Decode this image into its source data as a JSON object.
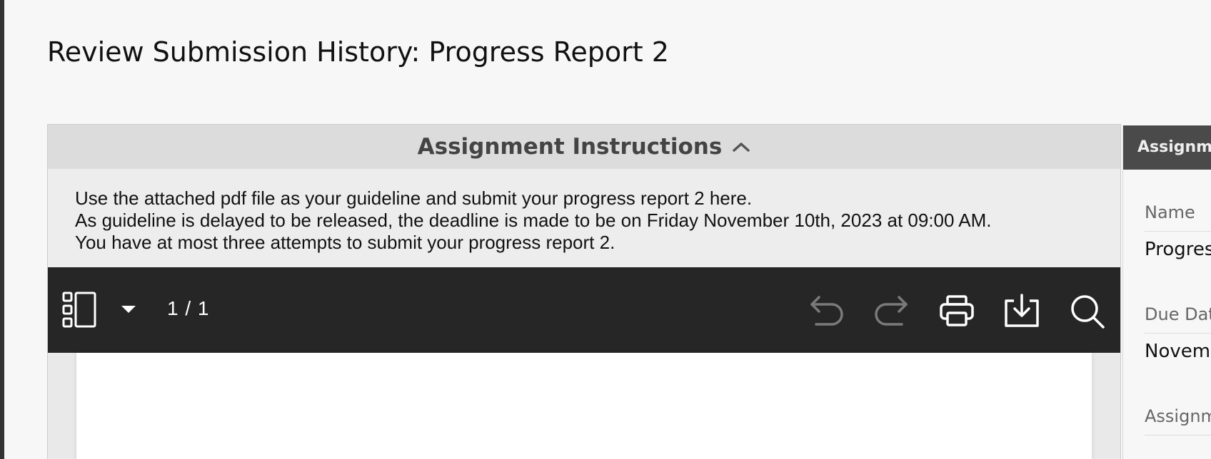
{
  "page": {
    "title": "Review Submission History: Progress Report 2"
  },
  "instructions": {
    "header_label": "Assignment Instructions",
    "toggle_icon": "chevron-up-icon",
    "lines": [
      "Use the attached pdf file as your guideline and submit your progress report 2 here.",
      "As guideline is delayed to be released, the deadline is made to be on Friday November 10th, 2023 at 09:00 AM.",
      "You have at most three attempts to submit your progress report 2."
    ]
  },
  "pdf_toolbar": {
    "page_indicator": "1 / 1",
    "icons": {
      "sidebar": "sidebar-toggle-icon",
      "dropdown": "caret-down-icon",
      "undo": "undo-icon",
      "redo": "redo-icon",
      "print": "print-icon",
      "download": "download-icon",
      "search": "search-icon"
    }
  },
  "side_panel": {
    "header": "Assignme",
    "fields": [
      {
        "label": "Name",
        "value": "Progress"
      },
      {
        "label": "Due Date",
        "value": "Novemb"
      },
      {
        "label": "Assignm",
        "value": ""
      }
    ]
  },
  "colors": {
    "background": "#f7f7f7",
    "toolbar": "#262626",
    "instructions_bg": "#ededed",
    "instructions_header_bg": "#dcdcdc",
    "side_header_bg": "#4a4a4a"
  }
}
